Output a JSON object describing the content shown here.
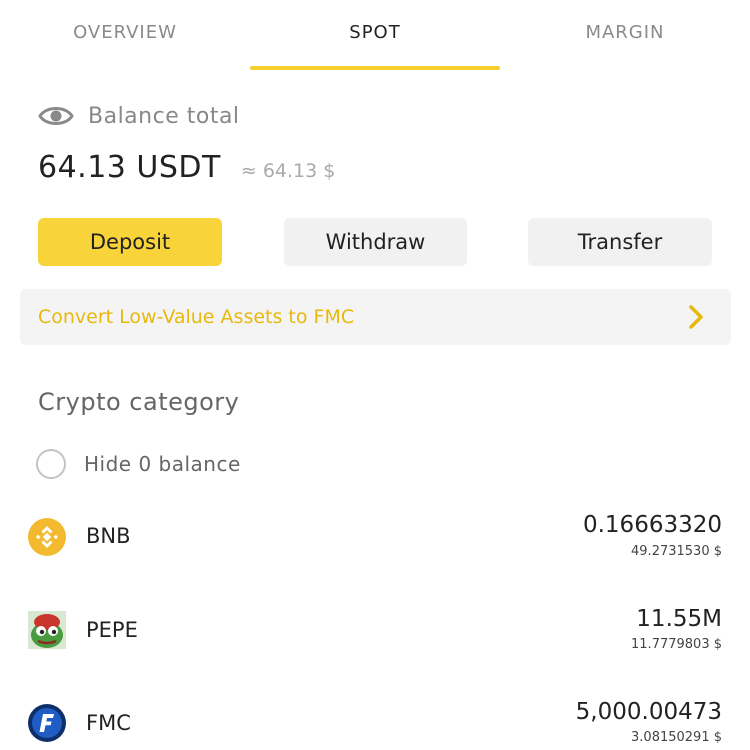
{
  "tabs": [
    {
      "label": "OVERVIEW",
      "active": false
    },
    {
      "label": "SPOT",
      "active": true
    },
    {
      "label": "MARGIN",
      "active": false
    }
  ],
  "balance": {
    "label": "Balance total",
    "value": "64.13 USDT",
    "approx": "≈ 64.13 $",
    "icon": "eye-icon"
  },
  "actions": {
    "deposit": "Deposit",
    "withdraw": "Withdraw",
    "transfer": "Transfer"
  },
  "convert": {
    "label": "Convert Low-Value Assets to FMC",
    "icon": "chevron-right-icon"
  },
  "category": {
    "title": "Crypto category",
    "hide_zero_label": "Hide 0 balance",
    "hide_zero_checked": false
  },
  "assets": [
    {
      "symbol": "BNB",
      "amount": "0.16663320",
      "usd": "49.2731530 $",
      "icon": "bnb-logo-icon"
    },
    {
      "symbol": "PEPE",
      "amount": "11.55M",
      "usd": "11.7779803 $",
      "icon": "pepe-logo-icon"
    },
    {
      "symbol": "FMC",
      "amount": "5,000.00473",
      "usd": "3.08150291 $",
      "icon": "fmc-logo-icon"
    }
  ],
  "colors": {
    "accent": "#f9d33a",
    "convert_text": "#e8b80c",
    "bnb": "#f3ba2f",
    "fmc": "#1f4e9c",
    "pepe": "#3e8b3a"
  }
}
